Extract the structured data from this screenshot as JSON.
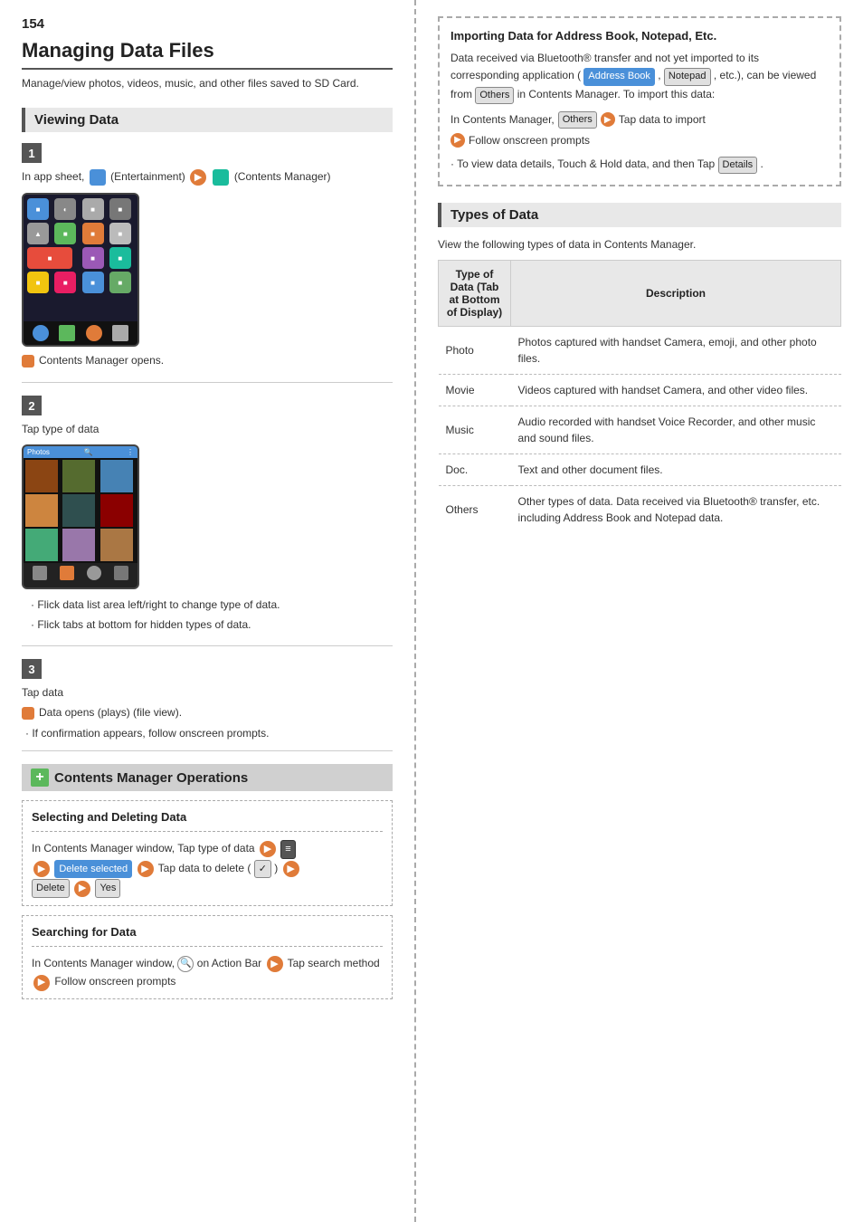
{
  "page": {
    "number": "154",
    "title": "Managing Data Files",
    "subtitle": "Manage/view photos, videos, music, and other files saved to SD Card."
  },
  "left": {
    "viewing_data": {
      "header": "Viewing Data",
      "step1": {
        "badge": "1",
        "text": "In app sheet,",
        "entertainment_label": "(Entertainment)",
        "contents_label": "(Contents Manager)"
      },
      "step1_note": "Contents Manager opens.",
      "step2": {
        "badge": "2",
        "text": "Tap type of data",
        "bullet1": "Flick data list area left/right to change type of data.",
        "bullet2": "Flick tabs at bottom for hidden types of data."
      },
      "step3": {
        "badge": "3",
        "text": "Tap data",
        "note1": "Data opens (plays) (file view).",
        "note2": "If confirmation appears, follow onscreen prompts."
      }
    },
    "contents_manager": {
      "header": "Contents Manager Operations",
      "selecting_title": "Selecting and Deleting Data",
      "selecting_text1": "In Contents Manager window, Tap type of data",
      "selecting_btn1": "Delete selected",
      "selecting_text2": "Tap data to delete (",
      "selecting_btn2": "Delete",
      "selecting_btn3": "Yes",
      "searching_title": "Searching for Data",
      "searching_text1": "In Contents Manager window,",
      "searching_text2": "on Action Bar",
      "searching_text3": "Tap search method",
      "searching_text4": "Follow onscreen prompts"
    }
  },
  "right": {
    "import": {
      "title": "Importing Data for Address Book, Notepad, Etc.",
      "text": "Data received via Bluetooth® transfer and not yet imported to its corresponding application (",
      "address_book_label": "Address Book",
      "notepad_label": "Notepad",
      "text2": ", etc.), can be viewed from",
      "others_label": "Others",
      "text3": "in Contents Manager. To import this data:",
      "step_label1": "In Contents Manager,",
      "step_others": "Others",
      "step_arrow": "→",
      "step_tap": "Tap data to import",
      "step_follow": "Follow onscreen prompts",
      "detail_text": "· To view data details, Touch & Hold data, and then Tap",
      "details_label": "Details"
    },
    "types": {
      "header": "Types of Data",
      "subtitle": "View the following types of data in Contents Manager.",
      "table_headers": {
        "col1": "Type of Data (Tab at Bottom of Display)",
        "col2": "Description"
      },
      "rows": [
        {
          "type": "Photo",
          "description": "Photos captured with handset Camera, emoji, and other photo files."
        },
        {
          "type": "Movie",
          "description": "Videos captured with handset Camera, and other video files."
        },
        {
          "type": "Music",
          "description": "Audio recorded with handset Voice Recorder, and other music and sound files."
        },
        {
          "type": "Doc.",
          "description": "Text and other document files."
        },
        {
          "type": "Others",
          "description": "Other types of data. Data received via Bluetooth® transfer, etc. including Address Book and Notepad data."
        }
      ]
    }
  }
}
